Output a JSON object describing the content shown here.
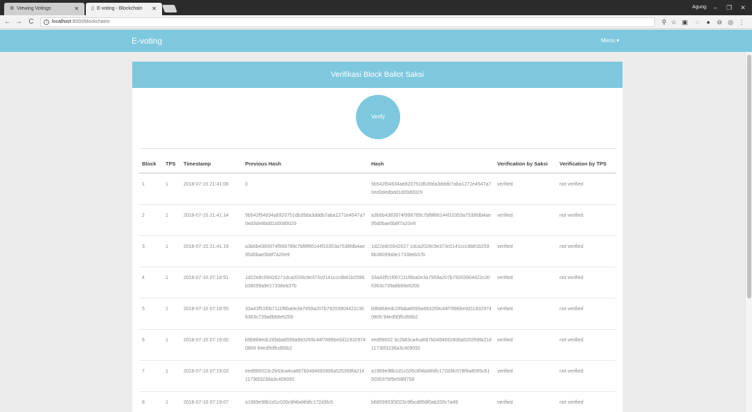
{
  "browser": {
    "tabs": [
      {
        "title": "Viewing Votings",
        "icon": "gear-icon"
      },
      {
        "title": "E-voting - Blockchain",
        "icon": "page-icon"
      }
    ],
    "user": "Agung",
    "url_host": "localhost",
    "url_rest": ":8000/blockchains"
  },
  "app": {
    "brand": "E-voting",
    "menu": "Menu ▾"
  },
  "panel": {
    "title": "Verifikasi Block Ballot Saksi",
    "verify_label": "Verify"
  },
  "table": {
    "headers": [
      "Block",
      "TPS",
      "Timestamp",
      "Previous Hash",
      "Hash",
      "Verification by Saksi",
      "Verification by TPS"
    ],
    "rows": [
      [
        "1",
        "1",
        "2018-07-15 21:41:06",
        "0",
        "5b542f54634a8920751db39da3dddb7aba1271e4547a70ed3de8bdd1d00d0029",
        "verified",
        "not verified"
      ],
      [
        "2",
        "1",
        "2018-07-15 21:41:14",
        "5b542f54634a8920751db39da3dddb7aba1271e4547a70ed3de8bdd1d00d0029",
        "a3b6b4383974f998789c7bf8f66144f10353a7538fdb4ae95d0bae5b8f7a20e9",
        "verified",
        "not verified"
      ],
      [
        "3",
        "1",
        "2018-07-15 21:41:19",
        "a3b6b4383974f998789c7bf8f66144f10353a7538fdb4ae95d0bae5b8f7a20e9",
        "1d22e8c5942627 1dca2028c9e373c0141ccc8b81b2596b38099a9e17338eb37b",
        "verified",
        "not verified"
      ],
      [
        "4",
        "1",
        "2018-07-16 07:18:51",
        "1d22e8c59426271dca2028c9e373c0141ccc8b81b2596b38099a9e17338eb37b",
        "33a43f51f0b7111f6ba0e3a7959a207b79203904422c306363c739a8b66e6200",
        "verified",
        "not verified"
      ],
      [
        "5",
        "1",
        "2018-07-16 07:18:55",
        "33a43f51f0b7111f6ba0e3a7959a207b79203904422c306363c739a8b66e6200",
        "b9b868edc26faba8599a683269c44f7896be0d119329740809 94ed50ffcd56b2",
        "verified",
        "not verified"
      ],
      [
        "6",
        "1",
        "2018-07-16 07:19:00",
        "b9b868edc26faba8599a683269c44f7896be0d119329740809 94ed50ffcd56b2",
        "eed98002 3c2b63ca4ca687b0484692806a520359fa21411736f3238a3c409092",
        "verified",
        "not verified"
      ],
      [
        "7",
        "1",
        "2018-07-16 07:19:03",
        "eed980023c2b63ca4ca687b0484692806a520359fa21411736f3238a3c409092",
        "a1969e98b1d1c026c8f4bd4fdfc172d3fc578f9a8085c61503537bf5e598f758",
        "verified",
        "not verified"
      ],
      [
        "8",
        "1",
        "2018-07-16 07:19:07",
        "a1969e98b1d1c026c8f4bd4fdfc172d3fc5",
        "b6859903f3023c9fbcd858f0ab200c7a46",
        "verified",
        "not verified"
      ]
    ]
  }
}
